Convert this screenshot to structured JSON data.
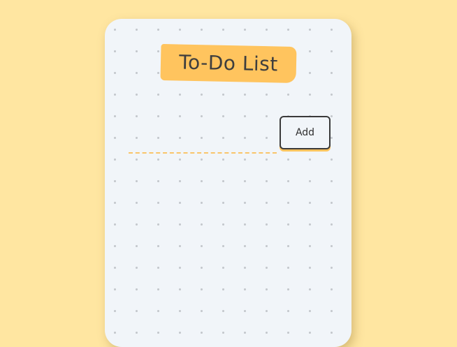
{
  "header": {
    "title": "To-Do List"
  },
  "form": {
    "input_value": "",
    "input_placeholder": "",
    "add_label": "Add"
  },
  "colors": {
    "page_background": "#FFE6A1",
    "card_background": "#F1F5F9",
    "title_highlight": "#FFC45E",
    "input_underline": "#F9C56A",
    "button_border": "#3A3A3A"
  }
}
